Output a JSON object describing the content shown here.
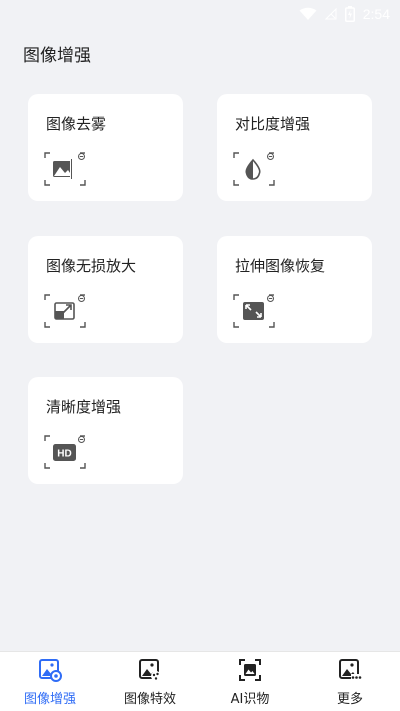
{
  "status_bar": {
    "time": "2:54"
  },
  "page": {
    "title": "图像增强"
  },
  "cards": [
    {
      "label": "图像去雾",
      "icon": "image-dehaze-icon"
    },
    {
      "label": "对比度增强",
      "icon": "contrast-icon"
    },
    {
      "label": "图像无损放大",
      "icon": "lossless-enlarge-icon"
    },
    {
      "label": "拉伸图像恢复",
      "icon": "stretch-restore-icon"
    },
    {
      "label": "清晰度增强",
      "icon": "hd-icon"
    }
  ],
  "bottom_nav": [
    {
      "label": "图像增强",
      "icon": "image-enhance-icon",
      "active": true
    },
    {
      "label": "图像特效",
      "icon": "image-effects-icon",
      "active": false
    },
    {
      "label": "AI识物",
      "icon": "ai-recognize-icon",
      "active": false
    },
    {
      "label": "更多",
      "icon": "more-icon",
      "active": false
    }
  ],
  "colors": {
    "accent": "#2f6cf6",
    "background": "#f1f2f5",
    "card": "#ffffff"
  }
}
